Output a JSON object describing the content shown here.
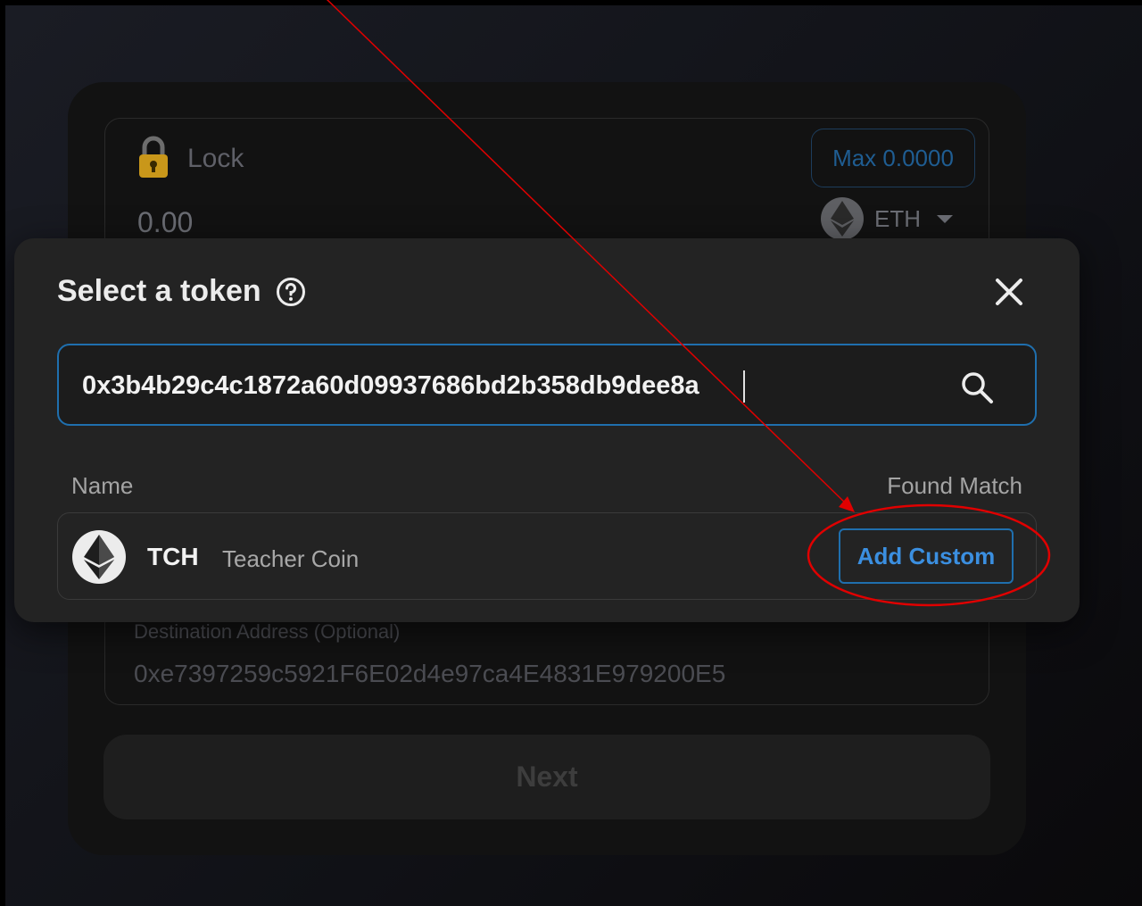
{
  "lock_panel": {
    "label": "Lock",
    "max_label": "Max 0.0000",
    "amount": "0.00",
    "token": "ETH",
    "destination_label": "Destination Address (Optional)",
    "destination_value": "0xe7397259c5921F6E02d4e97ca4E4831E979200E5"
  },
  "next_label": "Next",
  "modal": {
    "title": "Select a token",
    "search": {
      "value": "0x3b4b29c4c1872a60d09937686bd2b358db9dee8a"
    },
    "columns": {
      "name": "Name",
      "match": "Found Match"
    },
    "result": {
      "symbol": "TCH",
      "name": "Teacher Coin",
      "action_label": "Add Custom",
      "icon": "eth-logo"
    }
  },
  "colors": {
    "accent": "#1f6fae",
    "annotation": "#e00000",
    "lock_icon": "#c9971a"
  },
  "icons": [
    "lock-icon",
    "eth-icon",
    "help-icon",
    "close-icon",
    "search-icon"
  ]
}
